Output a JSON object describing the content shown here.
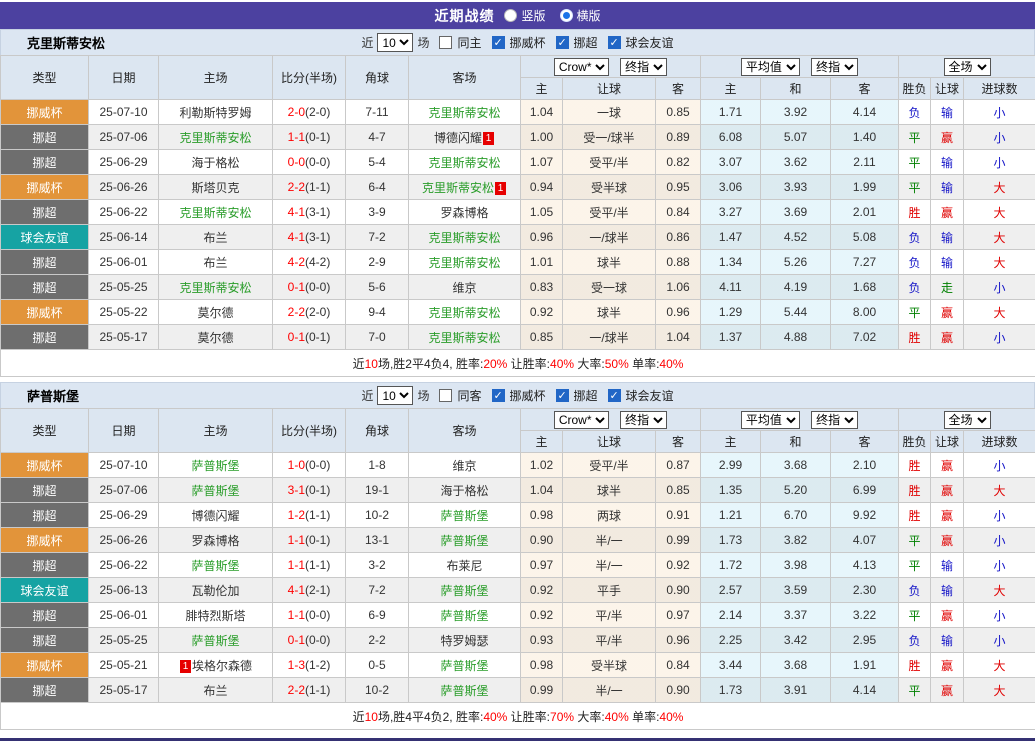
{
  "title_bar": {
    "title": "近期战绩",
    "radios": [
      {
        "label": "竖版",
        "checked": false
      },
      {
        "label": "横版",
        "checked": true
      }
    ]
  },
  "header": {
    "selects": {
      "bookmaker": "Crow*",
      "final_a": "终指",
      "average": "平均值",
      "final_b": "终指",
      "scope": "全场"
    },
    "cols": {
      "type": "类型",
      "date": "日期",
      "home": "主场",
      "score": "比分(半场)",
      "corner": "角球",
      "away": "客场",
      "h_home": "主",
      "h_line": "让球",
      "h_away": "客",
      "a_home": "主",
      "a_draw": "和",
      "a_away": "客",
      "r_outcome": "胜负",
      "r_handicap": "让球",
      "r_goals": "进球数"
    }
  },
  "filter_common": {
    "near": "近",
    "count": "10",
    "games": "场"
  },
  "tables": [
    {
      "team": "克里斯蒂安松",
      "same_label": "同主",
      "same_checked": false,
      "leagues": [
        "挪威杯",
        "挪超",
        "球会友谊"
      ],
      "rows": [
        {
          "type": "挪威杯",
          "date": "25-07-10",
          "home": "利勒斯特罗姆",
          "home_focus": false,
          "home_badge": "",
          "score": "2-0",
          "half": "(2-0)",
          "corner": "7-11",
          "away": "克里斯蒂安松",
          "away_focus": true,
          "away_badge": "",
          "crow": [
            "1.04",
            "一球",
            "0.85"
          ],
          "avg": [
            "1.71",
            "3.92",
            "4.14"
          ],
          "result": [
            "负",
            "输",
            "小"
          ]
        },
        {
          "type": "挪超",
          "date": "25-07-06",
          "home": "克里斯蒂安松",
          "home_focus": true,
          "home_badge": "",
          "score": "1-1",
          "half": "(0-1)",
          "corner": "4-7",
          "away": "博德闪耀",
          "away_focus": false,
          "away_badge": "1",
          "crow": [
            "1.00",
            "受一/球半",
            "0.89"
          ],
          "avg": [
            "6.08",
            "5.07",
            "1.40"
          ],
          "result": [
            "平",
            "赢",
            "小"
          ]
        },
        {
          "type": "挪超",
          "date": "25-06-29",
          "home": "海于格松",
          "home_focus": false,
          "home_badge": "",
          "score": "0-0",
          "half": "(0-0)",
          "corner": "5-4",
          "away": "克里斯蒂安松",
          "away_focus": true,
          "away_badge": "",
          "crow": [
            "1.07",
            "受平/半",
            "0.82"
          ],
          "avg": [
            "3.07",
            "3.62",
            "2.11"
          ],
          "result": [
            "平",
            "输",
            "小"
          ]
        },
        {
          "type": "挪威杯",
          "date": "25-06-26",
          "home": "斯塔贝克",
          "home_focus": false,
          "home_badge": "",
          "score": "2-2",
          "half": "(1-1)",
          "corner": "6-4",
          "away": "克里斯蒂安松",
          "away_focus": true,
          "away_badge": "1",
          "crow": [
            "0.94",
            "受半球",
            "0.95"
          ],
          "avg": [
            "3.06",
            "3.93",
            "1.99"
          ],
          "result": [
            "平",
            "输",
            "大"
          ]
        },
        {
          "type": "挪超",
          "date": "25-06-22",
          "home": "克里斯蒂安松",
          "home_focus": true,
          "home_badge": "",
          "score": "4-1",
          "half": "(3-1)",
          "corner": "3-9",
          "away": "罗森博格",
          "away_focus": false,
          "away_badge": "",
          "crow": [
            "1.05",
            "受平/半",
            "0.84"
          ],
          "avg": [
            "3.27",
            "3.69",
            "2.01"
          ],
          "result": [
            "胜",
            "赢",
            "大"
          ]
        },
        {
          "type": "球会友谊",
          "date": "25-06-14",
          "home": "布兰",
          "home_focus": false,
          "home_badge": "",
          "score": "4-1",
          "half": "(3-1)",
          "corner": "7-2",
          "away": "克里斯蒂安松",
          "away_focus": true,
          "away_badge": "",
          "crow": [
            "0.96",
            "一/球半",
            "0.86"
          ],
          "avg": [
            "1.47",
            "4.52",
            "5.08"
          ],
          "result": [
            "负",
            "输",
            "大"
          ]
        },
        {
          "type": "挪超",
          "date": "25-06-01",
          "home": "布兰",
          "home_focus": false,
          "home_badge": "",
          "score": "4-2",
          "half": "(4-2)",
          "corner": "2-9",
          "away": "克里斯蒂安松",
          "away_focus": true,
          "away_badge": "",
          "crow": [
            "1.01",
            "球半",
            "0.88"
          ],
          "avg": [
            "1.34",
            "5.26",
            "7.27"
          ],
          "result": [
            "负",
            "输",
            "大"
          ]
        },
        {
          "type": "挪超",
          "date": "25-05-25",
          "home": "克里斯蒂安松",
          "home_focus": true,
          "home_badge": "",
          "score": "0-1",
          "half": "(0-0)",
          "corner": "5-6",
          "away": "维京",
          "away_focus": false,
          "away_badge": "",
          "crow": [
            "0.83",
            "受一球",
            "1.06"
          ],
          "avg": [
            "4.11",
            "4.19",
            "1.68"
          ],
          "result": [
            "负",
            "走",
            "小"
          ]
        },
        {
          "type": "挪威杯",
          "date": "25-05-22",
          "home": "莫尔德",
          "home_focus": false,
          "home_badge": "",
          "score": "2-2",
          "half": "(2-0)",
          "corner": "9-4",
          "away": "克里斯蒂安松",
          "away_focus": true,
          "away_badge": "",
          "crow": [
            "0.92",
            "球半",
            "0.96"
          ],
          "avg": [
            "1.29",
            "5.44",
            "8.00"
          ],
          "result": [
            "平",
            "赢",
            "大"
          ]
        },
        {
          "type": "挪超",
          "date": "25-05-17",
          "home": "莫尔德",
          "home_focus": false,
          "home_badge": "",
          "score": "0-1",
          "half": "(0-1)",
          "corner": "7-0",
          "away": "克里斯蒂安松",
          "away_focus": true,
          "away_badge": "",
          "crow": [
            "0.85",
            "一/球半",
            "1.04"
          ],
          "avg": [
            "1.37",
            "4.88",
            "7.02"
          ],
          "result": [
            "胜",
            "赢",
            "小"
          ]
        }
      ],
      "summary": [
        {
          "t": "近",
          "r": false
        },
        {
          "t": "10",
          "r": true
        },
        {
          "t": "场,胜2平4负4, 胜率:",
          "r": false
        },
        {
          "t": "20%",
          "r": true
        },
        {
          "t": " 让胜率:",
          "r": false
        },
        {
          "t": "40%",
          "r": true
        },
        {
          "t": " 大率:",
          "r": false
        },
        {
          "t": "50%",
          "r": true
        },
        {
          "t": " 单率:",
          "r": false
        },
        {
          "t": "40%",
          "r": true
        }
      ]
    },
    {
      "team": "萨普斯堡",
      "same_label": "同客",
      "same_checked": false,
      "leagues": [
        "挪威杯",
        "挪超",
        "球会友谊"
      ],
      "rows": [
        {
          "type": "挪威杯",
          "date": "25-07-10",
          "home": "萨普斯堡",
          "home_focus": true,
          "home_badge": "",
          "score": "1-0",
          "half": "(0-0)",
          "corner": "1-8",
          "away": "维京",
          "away_focus": false,
          "away_badge": "",
          "crow": [
            "1.02",
            "受平/半",
            "0.87"
          ],
          "avg": [
            "2.99",
            "3.68",
            "2.10"
          ],
          "result": [
            "胜",
            "赢",
            "小"
          ]
        },
        {
          "type": "挪超",
          "date": "25-07-06",
          "home": "萨普斯堡",
          "home_focus": true,
          "home_badge": "",
          "score": "3-1",
          "half": "(0-1)",
          "corner": "19-1",
          "away": "海于格松",
          "away_focus": false,
          "away_badge": "",
          "crow": [
            "1.04",
            "球半",
            "0.85"
          ],
          "avg": [
            "1.35",
            "5.20",
            "6.99"
          ],
          "result": [
            "胜",
            "赢",
            "大"
          ]
        },
        {
          "type": "挪超",
          "date": "25-06-29",
          "home": "博德闪耀",
          "home_focus": false,
          "home_badge": "",
          "score": "1-2",
          "half": "(1-1)",
          "corner": "10-2",
          "away": "萨普斯堡",
          "away_focus": true,
          "away_badge": "",
          "crow": [
            "0.98",
            "两球",
            "0.91"
          ],
          "avg": [
            "1.21",
            "6.70",
            "9.92"
          ],
          "result": [
            "胜",
            "赢",
            "小"
          ]
        },
        {
          "type": "挪威杯",
          "date": "25-06-26",
          "home": "罗森博格",
          "home_focus": false,
          "home_badge": "",
          "score": "1-1",
          "half": "(0-1)",
          "corner": "13-1",
          "away": "萨普斯堡",
          "away_focus": true,
          "away_badge": "",
          "crow": [
            "0.90",
            "半/一",
            "0.99"
          ],
          "avg": [
            "1.73",
            "3.82",
            "4.07"
          ],
          "result": [
            "平",
            "赢",
            "小"
          ]
        },
        {
          "type": "挪超",
          "date": "25-06-22",
          "home": "萨普斯堡",
          "home_focus": true,
          "home_badge": "",
          "score": "1-1",
          "half": "(1-1)",
          "corner": "3-2",
          "away": "布莱尼",
          "away_focus": false,
          "away_badge": "",
          "crow": [
            "0.97",
            "半/一",
            "0.92"
          ],
          "avg": [
            "1.72",
            "3.98",
            "4.13"
          ],
          "result": [
            "平",
            "输",
            "小"
          ]
        },
        {
          "type": "球会友谊",
          "date": "25-06-13",
          "home": "瓦勒伦加",
          "home_focus": false,
          "home_badge": "",
          "score": "4-1",
          "half": "(2-1)",
          "corner": "7-2",
          "away": "萨普斯堡",
          "away_focus": true,
          "away_badge": "",
          "crow": [
            "0.92",
            "平手",
            "0.90"
          ],
          "avg": [
            "2.57",
            "3.59",
            "2.30"
          ],
          "result": [
            "负",
            "输",
            "大"
          ]
        },
        {
          "type": "挪超",
          "date": "25-06-01",
          "home": "腓特烈斯塔",
          "home_focus": false,
          "home_badge": "",
          "score": "1-1",
          "half": "(0-0)",
          "corner": "6-9",
          "away": "萨普斯堡",
          "away_focus": true,
          "away_badge": "",
          "crow": [
            "0.92",
            "平/半",
            "0.97"
          ],
          "avg": [
            "2.14",
            "3.37",
            "3.22"
          ],
          "result": [
            "平",
            "赢",
            "小"
          ]
        },
        {
          "type": "挪超",
          "date": "25-05-25",
          "home": "萨普斯堡",
          "home_focus": true,
          "home_badge": "",
          "score": "0-1",
          "half": "(0-0)",
          "corner": "2-2",
          "away": "特罗姆瑟",
          "away_focus": false,
          "away_badge": "",
          "crow": [
            "0.93",
            "平/半",
            "0.96"
          ],
          "avg": [
            "2.25",
            "3.42",
            "2.95"
          ],
          "result": [
            "负",
            "输",
            "小"
          ]
        },
        {
          "type": "挪威杯",
          "date": "25-05-21",
          "home": "埃格尔森德",
          "home_focus": false,
          "home_badge": "1",
          "score": "1-3",
          "half": "(1-2)",
          "corner": "0-5",
          "away": "萨普斯堡",
          "away_focus": true,
          "away_badge": "",
          "crow": [
            "0.98",
            "受半球",
            "0.84"
          ],
          "avg": [
            "3.44",
            "3.68",
            "1.91"
          ],
          "result": [
            "胜",
            "赢",
            "大"
          ]
        },
        {
          "type": "挪超",
          "date": "25-05-17",
          "home": "布兰",
          "home_focus": false,
          "home_badge": "",
          "score": "2-2",
          "half": "(1-1)",
          "corner": "10-2",
          "away": "萨普斯堡",
          "away_focus": true,
          "away_badge": "",
          "crow": [
            "0.99",
            "半/一",
            "0.90"
          ],
          "avg": [
            "1.73",
            "3.91",
            "4.14"
          ],
          "result": [
            "平",
            "赢",
            "大"
          ]
        }
      ],
      "summary": [
        {
          "t": "近",
          "r": false
        },
        {
          "t": "10",
          "r": true
        },
        {
          "t": "场,胜4平4负2, 胜率:",
          "r": false
        },
        {
          "t": "40%",
          "r": true
        },
        {
          "t": " 让胜率:",
          "r": false
        },
        {
          "t": "70%",
          "r": true
        },
        {
          "t": " 大率:",
          "r": false
        },
        {
          "t": "40%",
          "r": true
        },
        {
          "t": " 单率:",
          "r": false
        },
        {
          "t": "40%",
          "r": true
        }
      ]
    }
  ],
  "colors": {
    "accent_purple": "#4c41a0",
    "cup_orange": "#e2943a",
    "league_gray": "#6e6e6e",
    "friendly_teal": "#16a3a3",
    "focus_green": "#2a9d2a",
    "score_red": "#ff0000",
    "win_red": "#e00000",
    "draw_green": "#008000",
    "lose_blue": "#1515c8"
  }
}
